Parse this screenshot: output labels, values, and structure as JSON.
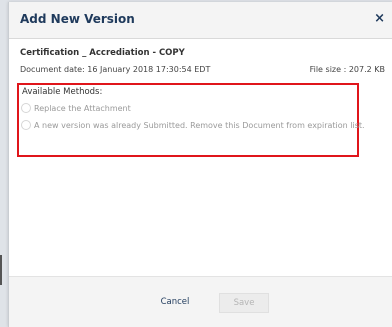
{
  "dialog": {
    "title": "Add New Version",
    "close_symbol": "×"
  },
  "document": {
    "name": "Certification _ Accrediation - COPY",
    "date": "Document date: 16 January 2018 17:30:54 EDT",
    "file_size": "File size : 207.2 KB"
  },
  "methods": {
    "title": "Available Methods:",
    "options": [
      {
        "label": "Replace the Attachment",
        "selected": false
      },
      {
        "label": "A new version was already Submitted. Remove this Document from expiration list.",
        "selected": false
      }
    ],
    "highlight_color": "#e0151b"
  },
  "footer": {
    "cancel_label": "Cancel",
    "save_label": "Save"
  }
}
